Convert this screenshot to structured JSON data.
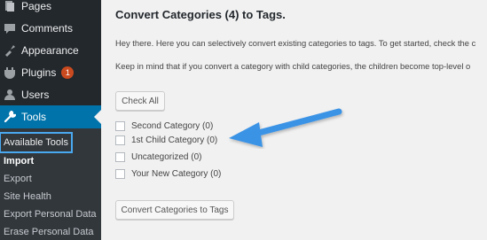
{
  "sidebar": {
    "items": [
      {
        "label": "Pages",
        "icon": "pages-icon"
      },
      {
        "label": "Comments",
        "icon": "comments-icon"
      },
      {
        "label": "Appearance",
        "icon": "appearance-icon"
      },
      {
        "label": "Plugins",
        "icon": "plugins-icon",
        "badge": "1"
      },
      {
        "label": "Users",
        "icon": "users-icon"
      },
      {
        "label": "Tools",
        "icon": "tools-icon",
        "active": true
      }
    ],
    "submenu": [
      {
        "label": "Available Tools"
      },
      {
        "label": "Import"
      },
      {
        "label": "Export"
      },
      {
        "label": "Site Health"
      },
      {
        "label": "Export Personal Data"
      },
      {
        "label": "Erase Personal Data"
      }
    ]
  },
  "main": {
    "title": "Convert Categories (4) to Tags.",
    "intro1": "Hey there. Here you can selectively convert existing categories to tags. To get started, check the c",
    "intro2": "Keep in mind that if you convert a category with child categories, the children become top-level o",
    "check_all_label": "Check All",
    "categories": [
      {
        "label": "Second Category (0)"
      },
      {
        "label": "1st Child Category (0)"
      },
      {
        "label": "Uncategorized (0)"
      },
      {
        "label": "Your New Category (0)"
      }
    ],
    "convert_label": "Convert Categories to Tags"
  },
  "colors": {
    "sidebar_bg": "#23282d",
    "submenu_bg": "#32373c",
    "active_blue": "#0073aa",
    "arrow_blue": "#3a93e6",
    "highlight_outline": "#4aa8f0",
    "badge": "#ca4a1f"
  }
}
